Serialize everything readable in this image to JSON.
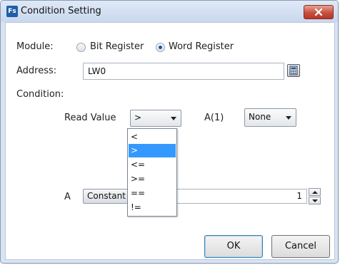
{
  "window": {
    "title": "Condition Setting",
    "icon_label": "Fs"
  },
  "module": {
    "label": "Module:",
    "options": [
      {
        "label": "Bit Register",
        "checked": false
      },
      {
        "label": "Word Register",
        "checked": true
      }
    ]
  },
  "address": {
    "label": "Address:",
    "value": "LW0"
  },
  "condition": {
    "label": "Condition:",
    "read_value_label": "Read Value",
    "operator_selected": ">",
    "operator_options": [
      "<",
      ">",
      "<=",
      ">=",
      "==",
      "!="
    ],
    "a1_label": "A(1)",
    "a1_value": "None",
    "a_label": "A",
    "a_type": "Constant",
    "a_value": "1"
  },
  "buttons": {
    "ok": "OK",
    "cancel": "Cancel"
  },
  "colors": {
    "selection": "#3399ff",
    "title_bar": "#d9e4f3",
    "close_button": "#c6503f"
  }
}
